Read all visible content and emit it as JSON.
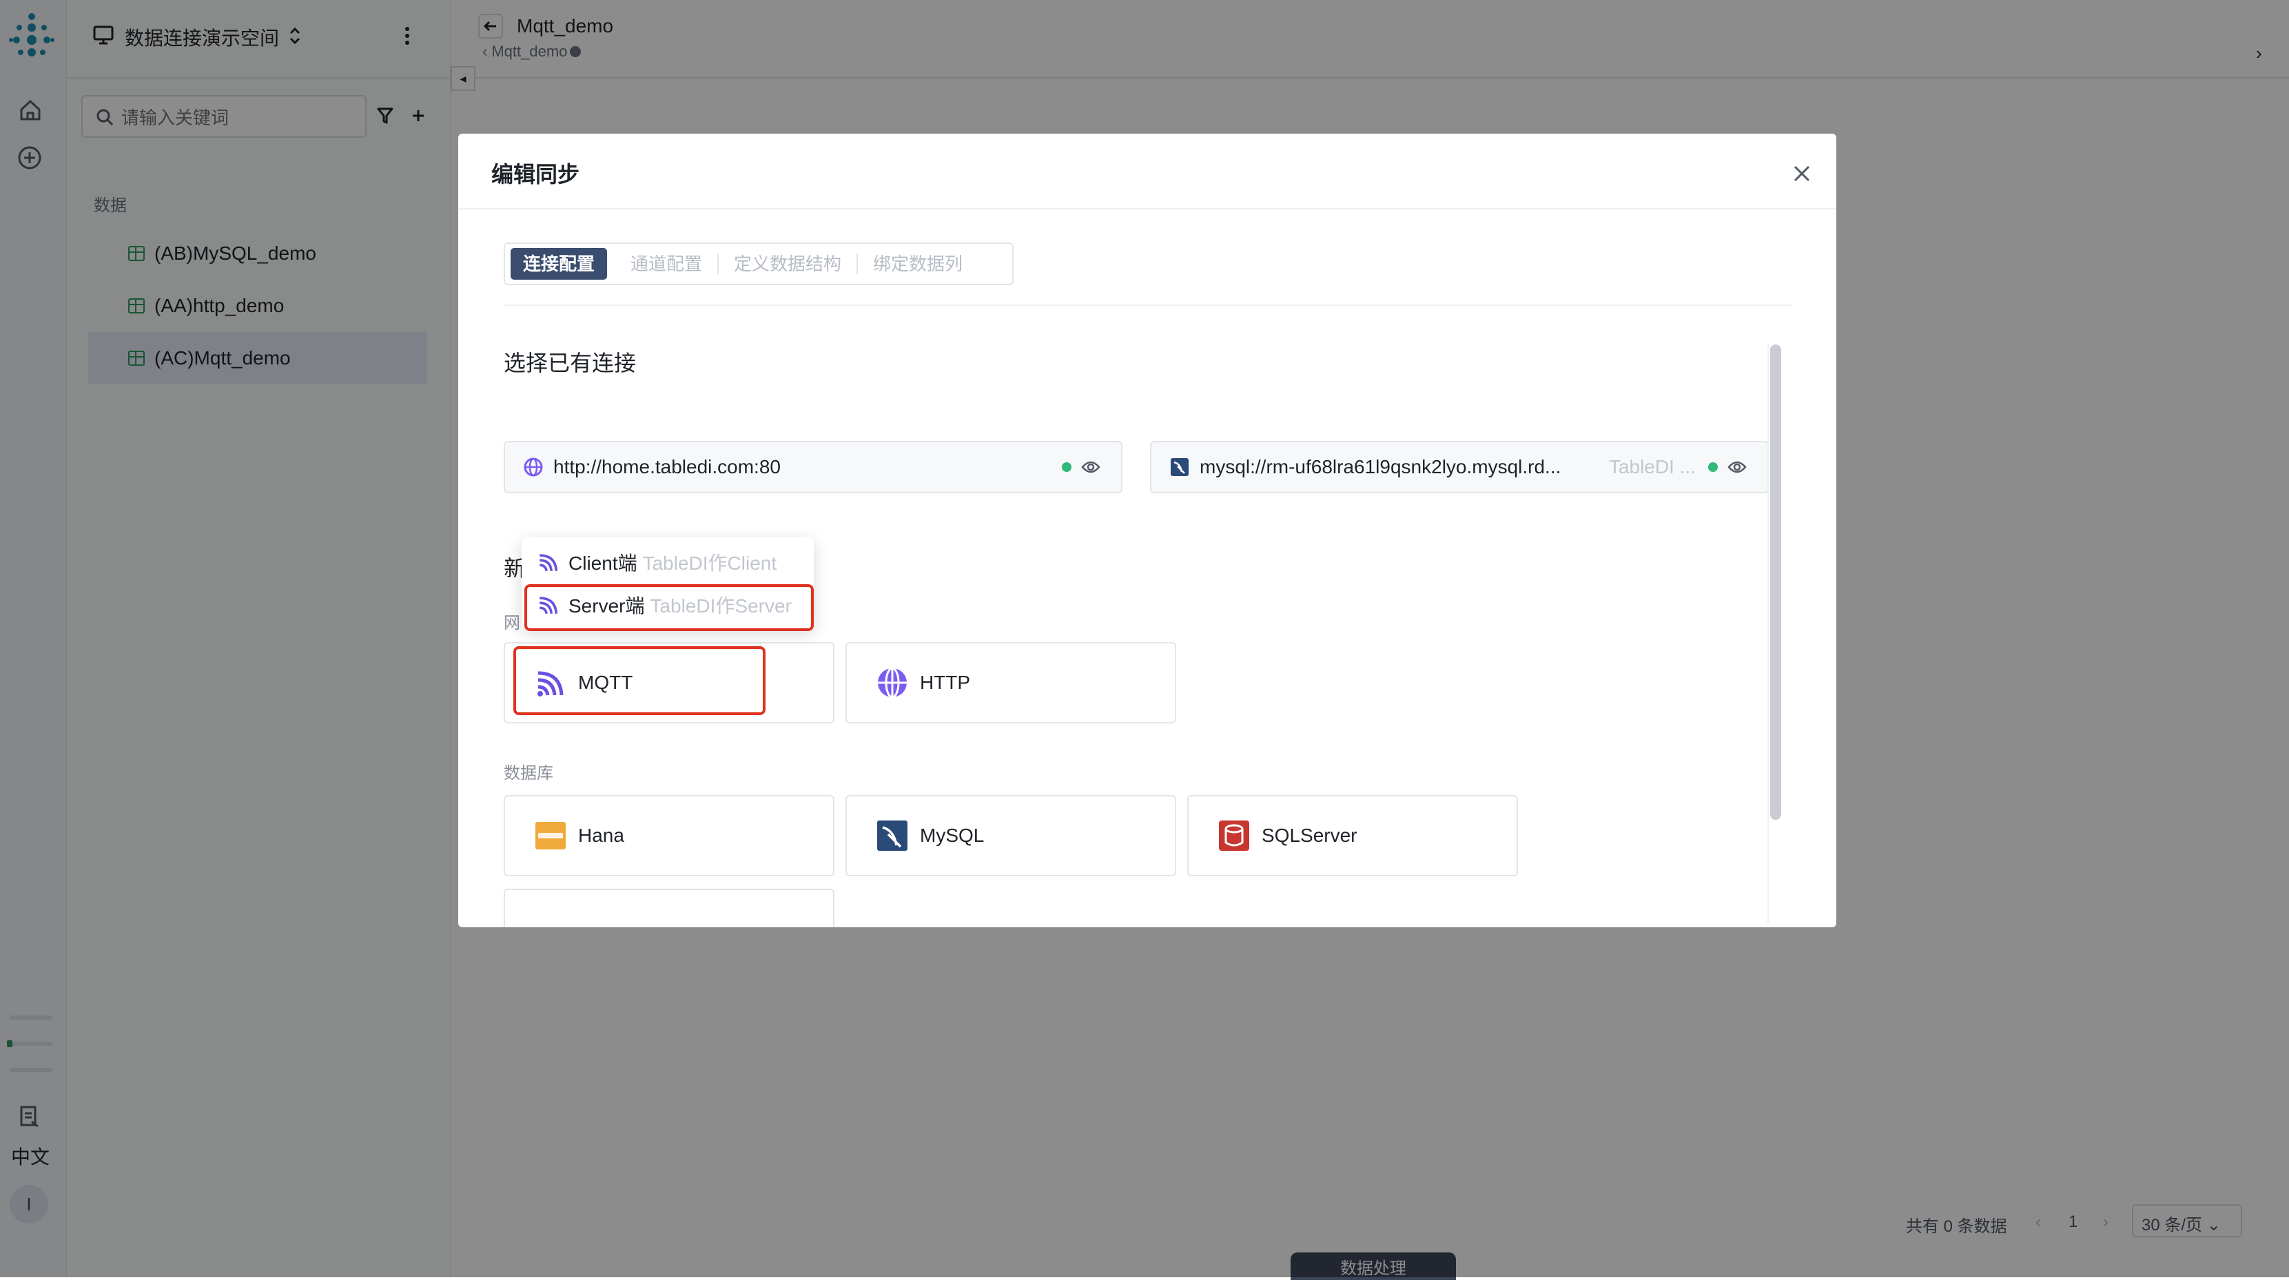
{
  "workspace": {
    "title": "数据连接演示空间"
  },
  "search": {
    "placeholder": "请输入关键词"
  },
  "tree": {
    "section_label": "数据",
    "items": [
      {
        "label": "(AB)MySQL_demo"
      },
      {
        "label": "(AA)http_demo"
      },
      {
        "label": "(AC)Mqtt_demo"
      }
    ]
  },
  "header": {
    "title": "Mqtt_demo",
    "breadcrumb": "Mqtt_demo"
  },
  "rail": {
    "language": "中文",
    "avatar_letter": "I"
  },
  "pagination": {
    "total": "共有 0 条数据",
    "page": "1",
    "page_size": "30 条/页"
  },
  "bottom_tab": {
    "label": "数据处理"
  },
  "modal": {
    "title": "编辑同步",
    "steps": [
      "连接配置",
      "通道配置",
      "定义数据结构",
      "绑定数据列"
    ],
    "existing_title": "选择已有连接",
    "existing_connections": [
      {
        "url": "http://home.tabledi.com:80",
        "tag": ""
      },
      {
        "url": "mysql://rm-uf68lra61l9qsnk2lyo.mysql.rd...",
        "tag": "TableDI ..."
      }
    ],
    "new_title": "新",
    "network_label": "网",
    "network_cards": [
      "MQTT",
      "HTTP"
    ],
    "database_label": "数据库",
    "database_cards": [
      "Hana",
      "MySQL",
      "SQLServer"
    ],
    "dropdown": [
      {
        "label": "Client端",
        "hint": "TableDI作Client"
      },
      {
        "label": "Server端",
        "hint": "TableDI作Server"
      }
    ]
  },
  "colors": {
    "accent": "#3b4d6e",
    "highlight": "#e0321f",
    "status_ok": "#2fb97b",
    "mqtt": "#6b4fe0"
  }
}
